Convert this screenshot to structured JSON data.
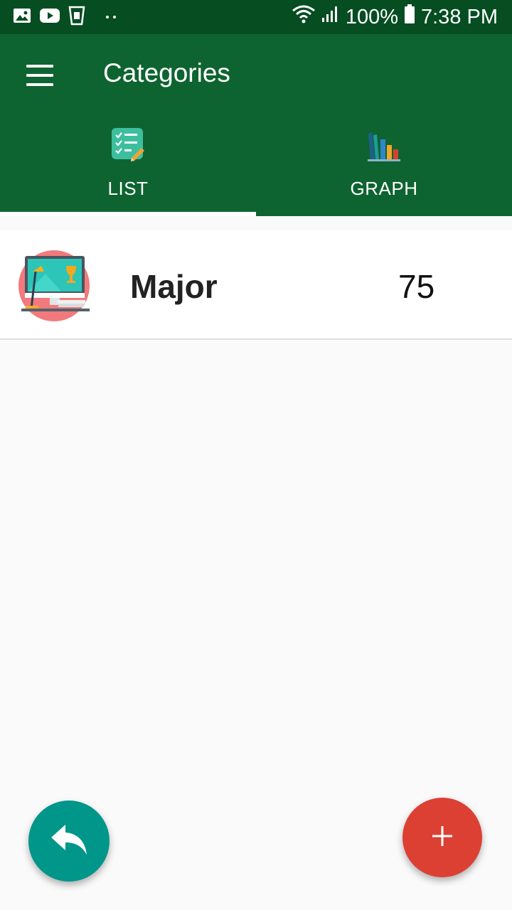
{
  "status_bar": {
    "battery": "100%",
    "time": "7:38 PM",
    "icons": [
      "gallery-icon",
      "youtube-icon",
      "cup-icon",
      "dots-icon",
      "wifi-icon",
      "signal-icon",
      "battery-icon"
    ]
  },
  "app_bar": {
    "title": "Categories",
    "menu_icon": "hamburger-menu-icon"
  },
  "tabs": [
    {
      "label": "LIST",
      "icon": "checklist-icon",
      "selected": true
    },
    {
      "label": "GRAPH",
      "icon": "bar-chart-icon",
      "selected": false
    }
  ],
  "categories": [
    {
      "name": "Major",
      "value": "75",
      "icon": "desk-computer-icon"
    }
  ],
  "fabs": {
    "back_icon": "reply-arrow-icon",
    "add_label": "+"
  },
  "colors": {
    "status_bar": "#064d22",
    "primary": "#0e6430",
    "back_fab": "#00968a",
    "add_fab": "#dc4033",
    "avatar_bg": "#f27a7c"
  }
}
